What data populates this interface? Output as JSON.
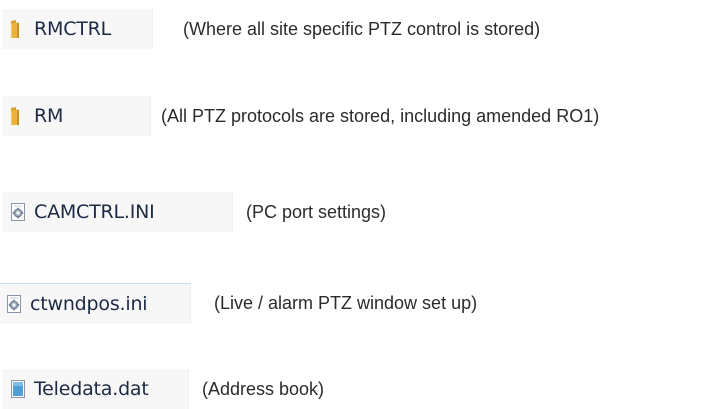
{
  "items": [
    {
      "name": "RMCTRL",
      "icon": "folder-icon",
      "description": "(Where all site specific PTZ control is stored)"
    },
    {
      "name": "RM",
      "icon": "folder-icon",
      "description": "(All PTZ protocols are stored, including amended RO1)"
    },
    {
      "name": "CAMCTRL.INI",
      "icon": "ini-settings-file-icon",
      "description": "(PC port settings)"
    },
    {
      "name": "ctwndpos.ini",
      "icon": "ini-settings-file-icon",
      "description": "(Live / alarm PTZ window set up)"
    },
    {
      "name": "Teledata.dat",
      "icon": "generic-file-icon",
      "description": "(Address book)"
    }
  ],
  "colors": {
    "folder": "#e8b43c",
    "filename_text": "#1d2a45",
    "description_text": "#2b2b2b",
    "item_background": "#f7f7f7"
  }
}
